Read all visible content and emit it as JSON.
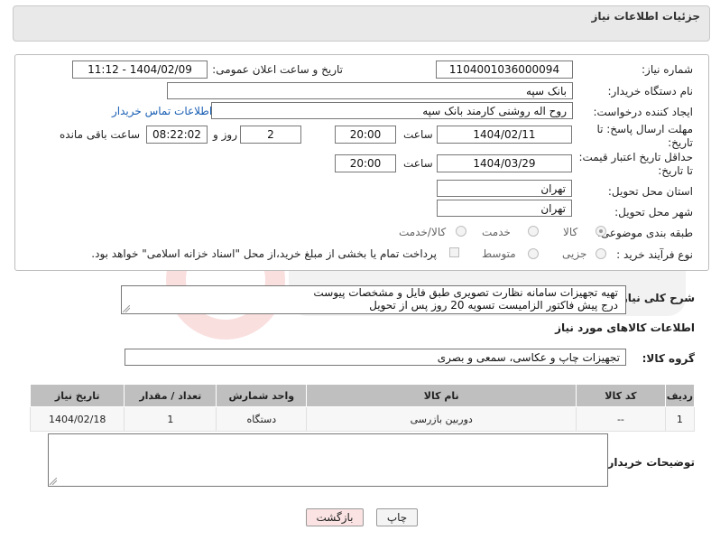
{
  "header": {
    "title": "جزئیات اطلاعات نیاز"
  },
  "form": {
    "need_number": {
      "label": "شماره نیاز:",
      "value": "1104001036000094"
    },
    "announce_date": {
      "label": "تاریخ و ساعت اعلان عمومی:",
      "value": "1404/02/09 - 11:12"
    },
    "buyer_org": {
      "label": "نام دستگاه خریدار:",
      "value": "بانک سپه"
    },
    "requester": {
      "label": "ایجاد کننده درخواست:",
      "value": "روح اله روشنی کارمند بانک سپه",
      "contact_link": "اطلاعات تماس خریدار"
    },
    "reply_deadline": {
      "label_line1": "مهلت ارسال پاسخ: تا",
      "label_line2": "تاریخ:",
      "date": "1404/02/11",
      "time_label": "ساعت",
      "time": "20:00",
      "days": "2",
      "days_label": "روز و",
      "remaining": "08:22:02",
      "remaining_label": "ساعت باقی مانده"
    },
    "price_validity": {
      "label_line1": "حداقل تاریخ اعتبار قیمت:",
      "label_line2": "تا تاریخ:",
      "date": "1404/03/29",
      "time_label": "ساعت",
      "time": "20:00"
    },
    "delivery_province": {
      "label": "استان محل تحویل:",
      "value": "تهران"
    },
    "delivery_city": {
      "label": "شهر محل تحویل:",
      "value": "تهران"
    },
    "category": {
      "label": "طبقه بندی موضوعی:",
      "options": [
        "کالا",
        "خدمت",
        "کالا/خدمت"
      ],
      "selected": "کالا"
    },
    "purchase_type": {
      "label": "نوع فرآیند خرید :",
      "options": [
        "جزیی",
        "متوسط"
      ],
      "payment_note": "پرداخت تمام یا بخشی از مبلغ خرید،از محل \"اسناد خزانه اسلامی\" خواهد بود."
    }
  },
  "description": {
    "label": "شرح کلی نیاز:",
    "line1": "تهیه تجهیزات سامانه نظارت تصویری طبق فایل و مشخصات پیوست",
    "line2": "درج پیش فاکتور الزامیست تسویه 20 روز پس از تحویل"
  },
  "goods_section": {
    "title": "اطلاعات کالاهای مورد نیاز"
  },
  "goods_group": {
    "label": "گروه کالا:",
    "value": "تجهیزات چاپ و عکاسی، سمعی و بصری"
  },
  "table": {
    "headers": [
      "ردیف",
      "کد کالا",
      "نام کالا",
      "واحد شمارش",
      "تعداد / مقدار",
      "تاریخ نیاز"
    ],
    "rows": [
      [
        "1",
        "--",
        "دوربین بازرسی",
        "دستگاه",
        "1",
        "1404/02/18"
      ]
    ]
  },
  "buyer_notes": {
    "label": "توضیحات خریدار:",
    "value": ""
  },
  "buttons": {
    "print": "چاپ",
    "back": "بازگشت"
  },
  "colors": {
    "link": "#1a5fb4",
    "header_bg": "#e9e9e9",
    "table_header": "#bfbfbf",
    "back_button_bg": "#fbe3e3"
  }
}
